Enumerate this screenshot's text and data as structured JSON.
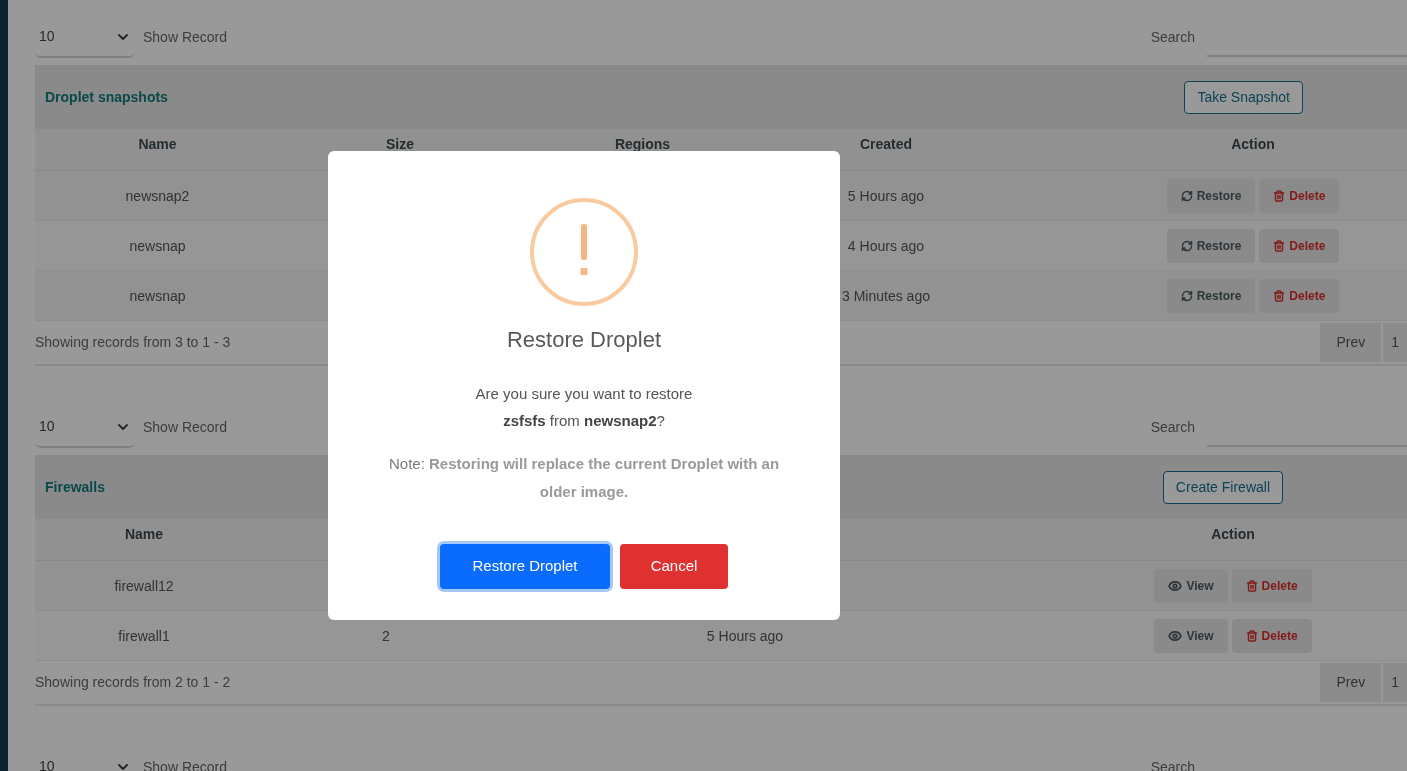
{
  "sections": [
    {
      "kind": "snapshots",
      "page_size": "10",
      "show_record_label": "Show Record",
      "search_label": "Search",
      "title": "Droplet snapshots",
      "action_button": "Take Snapshot",
      "columns": [
        "Name",
        "Size",
        "Regions",
        "Created",
        "Action"
      ],
      "rows": [
        {
          "name": "newsnap2",
          "created": "5 Hours ago",
          "actions": [
            {
              "kind": "restore",
              "label": "Restore"
            },
            {
              "kind": "delete",
              "label": "Delete"
            }
          ]
        },
        {
          "name": "newsnap",
          "created": "4 Hours ago",
          "actions": [
            {
              "kind": "restore",
              "label": "Restore"
            },
            {
              "kind": "delete",
              "label": "Delete"
            }
          ]
        },
        {
          "name": "newsnap",
          "created": "3 Minutes ago",
          "actions": [
            {
              "kind": "restore",
              "label": "Restore"
            },
            {
              "kind": "delete",
              "label": "Delete"
            }
          ]
        }
      ],
      "summary": "Showing records from 3 to 1 - 3",
      "pagination": [
        "Prev",
        "1"
      ]
    },
    {
      "kind": "firewalls",
      "page_size": "10",
      "show_record_label": "Show Record",
      "search_label": "Search",
      "title": "Firewalls",
      "action_button": "Create Firewall",
      "columns": [
        "Name",
        "Action"
      ],
      "rows": [
        {
          "name": "firewall12",
          "actions": [
            {
              "kind": "view",
              "label": "View"
            },
            {
              "kind": "delete",
              "label": "Delete"
            }
          ]
        },
        {
          "name": "firewall1",
          "column_2": "2",
          "column_3": "5 Hours ago",
          "actions": [
            {
              "kind": "view",
              "label": "View"
            },
            {
              "kind": "delete",
              "label": "Delete"
            }
          ]
        }
      ],
      "summary": "Showing records from 2 to 1 - 2",
      "pagination": [
        "Prev",
        "1"
      ]
    },
    {
      "kind": "cut",
      "page_size": "10",
      "show_record_label": "Show Record",
      "search_label": "Search"
    }
  ],
  "modal": {
    "title": "Restore Droplet",
    "message": "Are you sure you want to restore **zsfsfs** from **newsnap2**?",
    "note": "Note: **Restoring will replace the current Droplet with an older image.**",
    "confirm": "Restore Droplet",
    "cancel": "Cancel"
  }
}
